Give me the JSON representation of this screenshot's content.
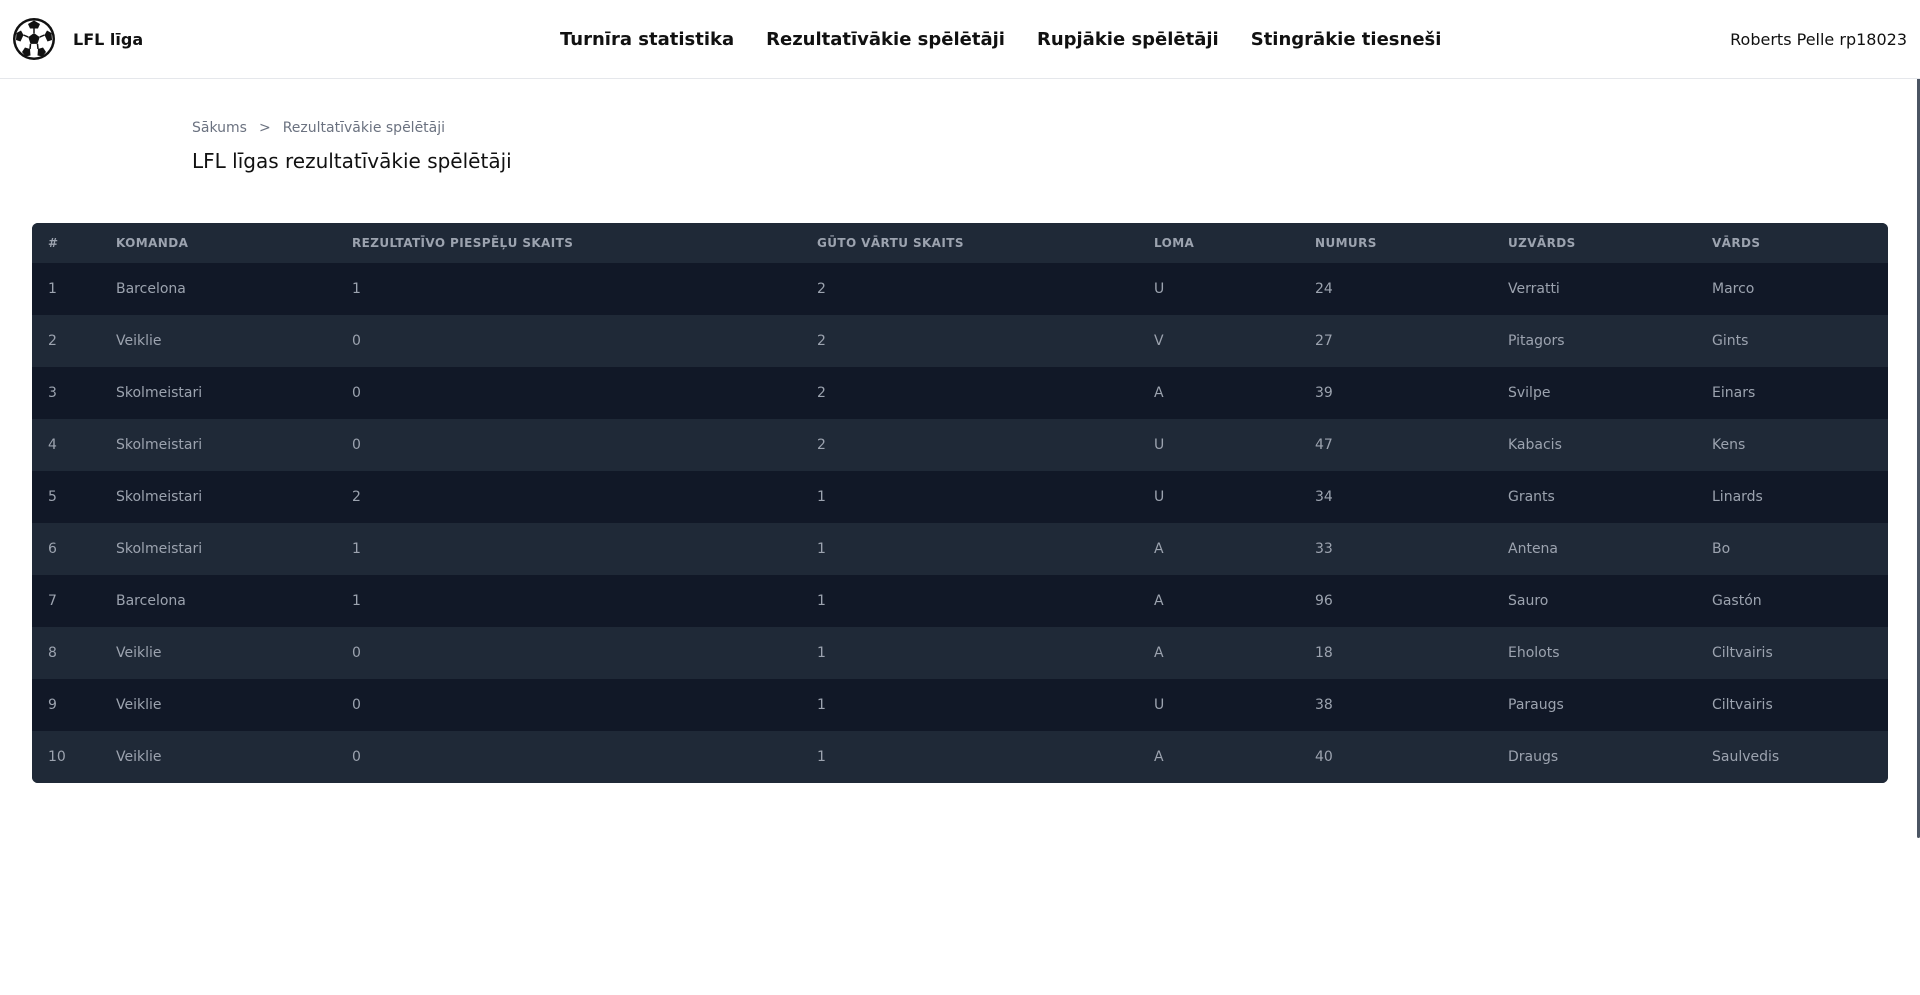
{
  "header": {
    "brand_name": "LFL līga",
    "nav": [
      {
        "label": "Turnīra statistika"
      },
      {
        "label": "Rezultatīvākie spēlētāji"
      },
      {
        "label": "Rupjākie spēlētāji"
      },
      {
        "label": "Stingrākie tiesneši"
      }
    ],
    "user": "Roberts Pelle rp18023"
  },
  "breadcrumb": {
    "home": "Sākums",
    "separator": ">",
    "current": "Rezultatīvākie spēlētāji"
  },
  "page_title": "LFL līgas rezultatīvākie spēlētāji",
  "table": {
    "columns": [
      "#",
      "KOMANDA",
      "REZULTATĪVO PIESPĒĻU SKAITS",
      "GŪTO VĀRTU SKAITS",
      "LOMA",
      "NUMURS",
      "UZVĀRDS",
      "VĀRDS"
    ],
    "rows": [
      [
        "1",
        "Barcelona",
        "1",
        "2",
        "U",
        "24",
        "Verratti",
        "Marco"
      ],
      [
        "2",
        "Veiklie",
        "0",
        "2",
        "V",
        "27",
        "Pitagors",
        "Gints"
      ],
      [
        "3",
        "Skolmeistari",
        "0",
        "2",
        "A",
        "39",
        "Svilpe",
        "Einars"
      ],
      [
        "4",
        "Skolmeistari",
        "0",
        "2",
        "U",
        "47",
        "Kabacis",
        "Kens"
      ],
      [
        "5",
        "Skolmeistari",
        "2",
        "1",
        "U",
        "34",
        "Grants",
        "Linards"
      ],
      [
        "6",
        "Skolmeistari",
        "1",
        "1",
        "A",
        "33",
        "Antena",
        "Bo"
      ],
      [
        "7",
        "Barcelona",
        "1",
        "1",
        "A",
        "96",
        "Sauro",
        "Gastón"
      ],
      [
        "8",
        "Veiklie",
        "0",
        "1",
        "A",
        "18",
        "Eholots",
        "Ciltvairis"
      ],
      [
        "9",
        "Veiklie",
        "0",
        "1",
        "U",
        "38",
        "Paraugs",
        "Ciltvairis"
      ],
      [
        "10",
        "Veiklie",
        "0",
        "1",
        "A",
        "40",
        "Draugs",
        "Saulvedis"
      ]
    ]
  },
  "icons": {
    "brand_logo": "soccer-ball-icon"
  },
  "colors": {
    "table_header_bg": "#1f2937",
    "table_row_dark": "#111827",
    "table_row_light": "#1f2937",
    "table_text": "#9ca3af"
  }
}
